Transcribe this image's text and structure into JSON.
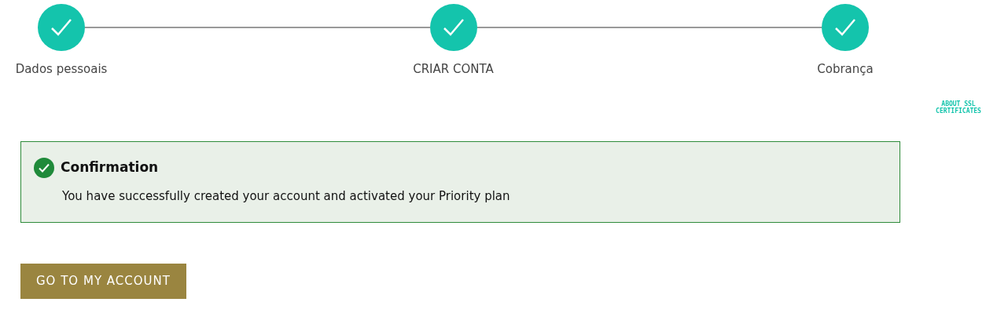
{
  "steps": [
    {
      "label": "Dados pessoais",
      "completed": true
    },
    {
      "label": "CRIAR CONTA",
      "completed": true
    },
    {
      "label": "Cobrança",
      "completed": true
    }
  ],
  "ssl_link": "ABOUT SSL CERTIFICATES",
  "alert": {
    "title": "Confirmation",
    "message": "You have successfully created your account and activated your Priority plan"
  },
  "button": "GO TO MY ACCOUNT"
}
